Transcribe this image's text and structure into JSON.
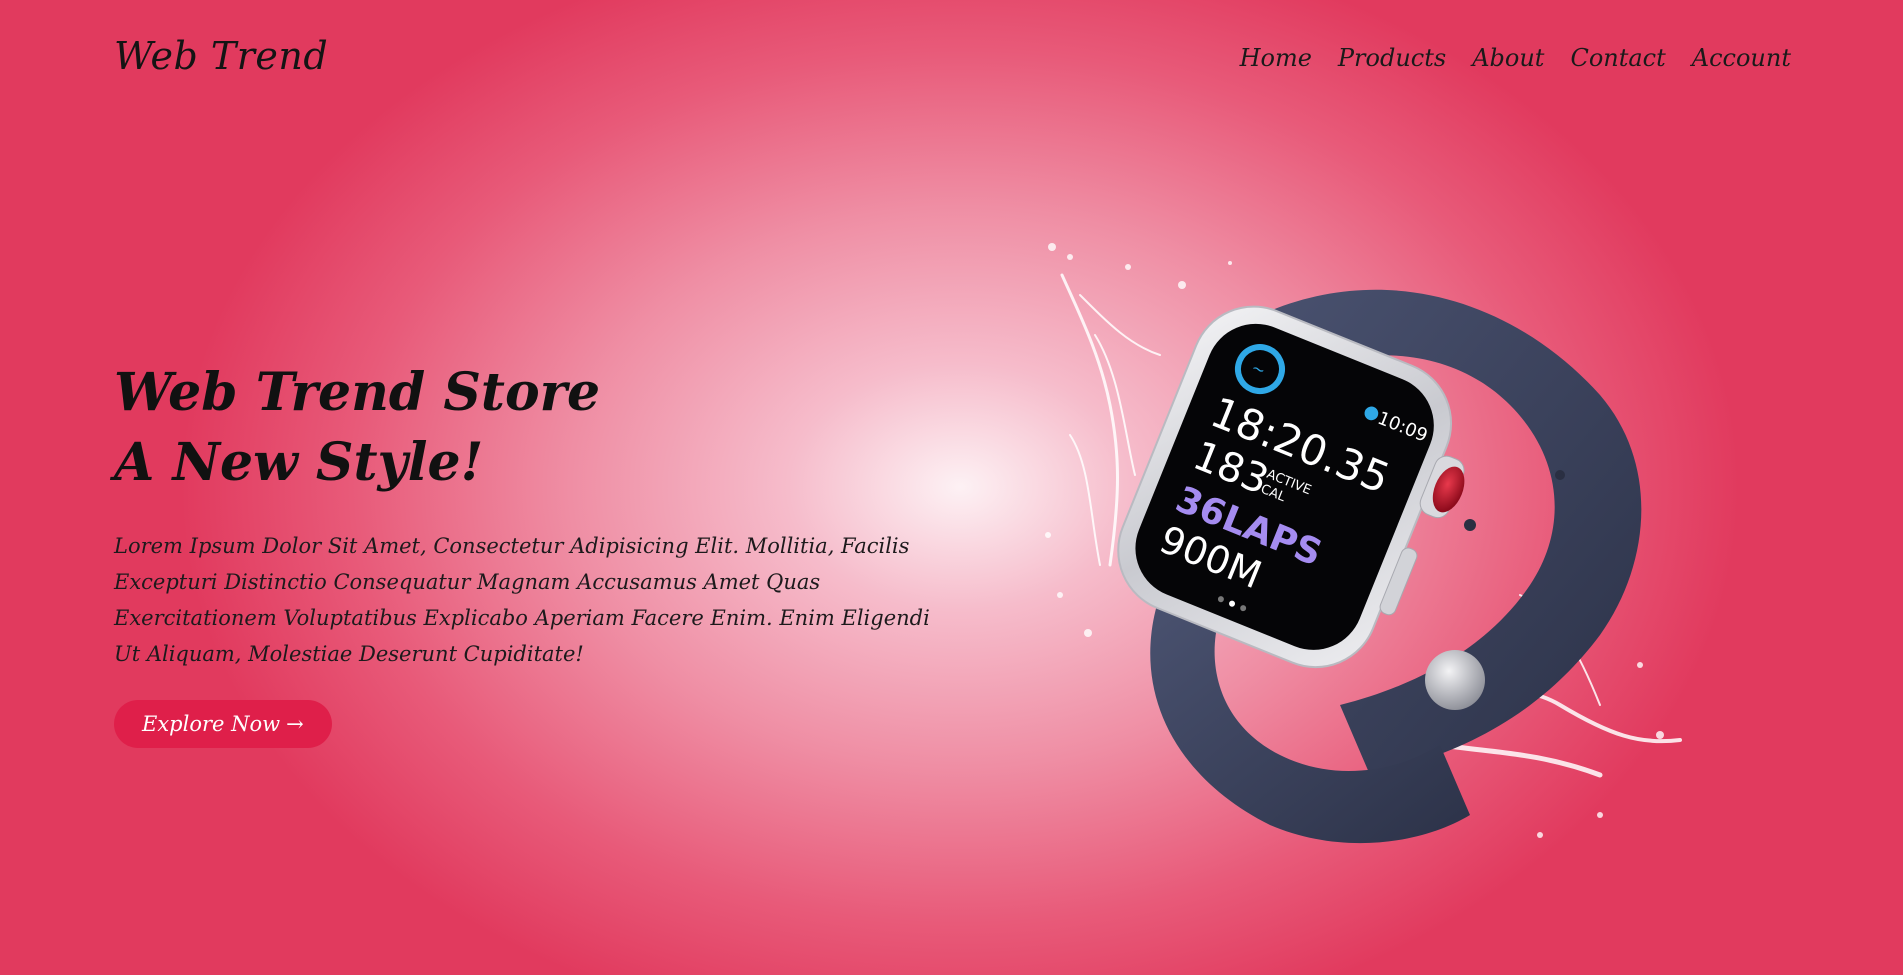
{
  "header": {
    "logo": "Web Trend",
    "nav": [
      {
        "label": "Home"
      },
      {
        "label": "Products"
      },
      {
        "label": "About"
      },
      {
        "label": "Contact"
      },
      {
        "label": "Account"
      }
    ]
  },
  "hero": {
    "title_line1": "Web Trend Store",
    "title_line2": "A New Style!",
    "description": "Lorem Ipsum Dolor Sit Amet, Consectetur Adipisicing Elit. Mollitia, Facilis Excepturi Distinctio Consequatur Magnam Accusamus Amet Quas Exercitationem Voluptatibus Explicabo Aperiam Facere Enim. Enim Eligendi Ut Aliquam, Molestiae Deserunt Cupiditate!",
    "cta_label": "Explore Now",
    "cta_arrow": "→"
  },
  "watch": {
    "time": "10:09",
    "elapsed": "18:20.35",
    "calories": "183",
    "calories_unit_1": "ACTIVE",
    "calories_unit_2": "CAL",
    "laps": "36LAPS",
    "distance": "900M"
  },
  "colors": {
    "accent": "#df1f4a",
    "band": "#3a4158",
    "crown_red": "#c0152a",
    "laps_purple": "#a58cf0",
    "ring_blue": "#2fa8e6"
  },
  "icons": {
    "watch_image": "smartwatch-splash-image",
    "ring": "activity-ring-icon",
    "swim": "swimmer-icon",
    "drop": "water-drop-icon"
  }
}
